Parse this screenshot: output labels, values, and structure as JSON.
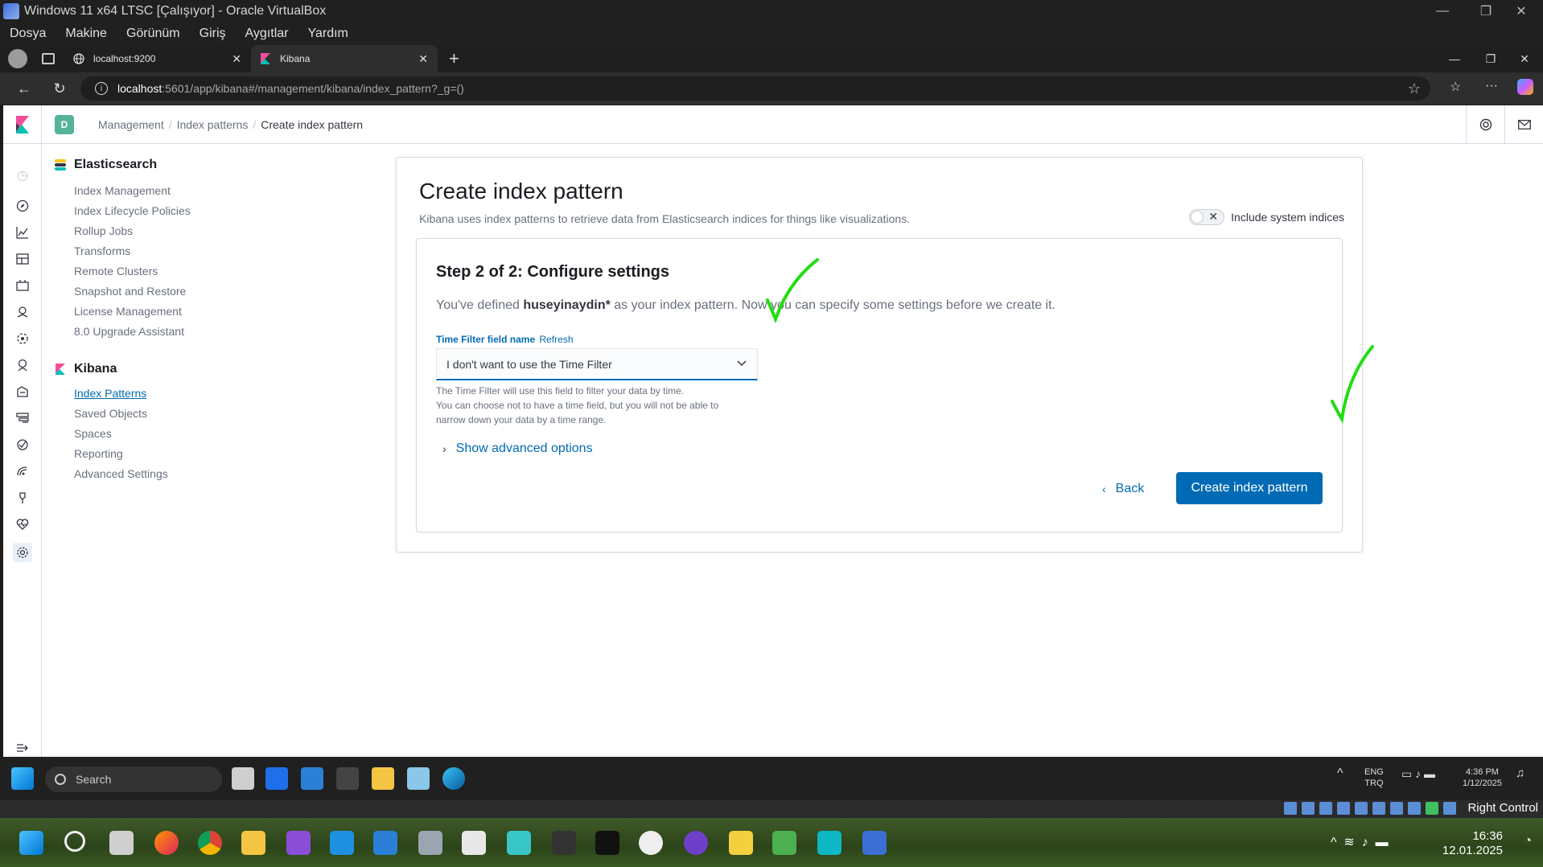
{
  "host": {
    "window_title": "Windows 11 x64 LTSC [Çalışıyor] - Oracle VirtualBox",
    "menu": [
      "Dosya",
      "Makine",
      "Görünüm",
      "Giriş",
      "Aygıtlar",
      "Yardım"
    ],
    "status_right": "Right Control",
    "clock_time": "16:36",
    "clock_date": "12.01.2025"
  },
  "browser": {
    "tabs": [
      {
        "label": "localhost:9200"
      },
      {
        "label": "Kibana"
      }
    ],
    "url_host": "localhost",
    "url_path": ":5601/app/kibana#/management/kibana/index_pattern?_g=()"
  },
  "kibana": {
    "space_initial": "D",
    "breadcrumbs": [
      "Management",
      "Index patterns",
      "Create index pattern"
    ],
    "sidenav": {
      "elasticsearch_title": "Elasticsearch",
      "elasticsearch_items": [
        "Index Management",
        "Index Lifecycle Policies",
        "Rollup Jobs",
        "Transforms",
        "Remote Clusters",
        "Snapshot and Restore",
        "License Management",
        "8.0 Upgrade Assistant"
      ],
      "kibana_title": "Kibana",
      "kibana_items": [
        "Index Patterns",
        "Saved Objects",
        "Spaces",
        "Reporting",
        "Advanced Settings"
      ],
      "active_item": "Index Patterns"
    },
    "page_title": "Create index pattern",
    "subtitle": "Kibana uses index patterns to retrieve data from Elasticsearch indices for things like visualizations.",
    "include_system_label": "Include system indices",
    "include_system_enabled": false,
    "step_title": "Step 2 of 2: Configure settings",
    "desc_prefix": "You've defined ",
    "desc_pattern": "huseyinaydin*",
    "desc_suffix": " as your index pattern. Now you can specify some settings before we create it.",
    "time_field_label": "Time Filter field name",
    "refresh_label": "Refresh",
    "time_field_value": "I don't want to use the Time Filter",
    "help_line1": "The Time Filter will use this field to filter your data by time.",
    "help_line2": "You can choose not to have a time field, but you will not be able to",
    "help_line3": "narrow down your data by a time range.",
    "advanced_label": "Show advanced options",
    "back_label": "Back",
    "create_label": "Create index pattern"
  },
  "guest_taskbar": {
    "search_placeholder": "Search",
    "lang_top": "ENG",
    "lang_bottom": "TRQ",
    "time": "4:36 PM",
    "date": "1/12/2025"
  },
  "colors": {
    "primary": "#006bb4",
    "annotation_green": "#22dd11"
  }
}
